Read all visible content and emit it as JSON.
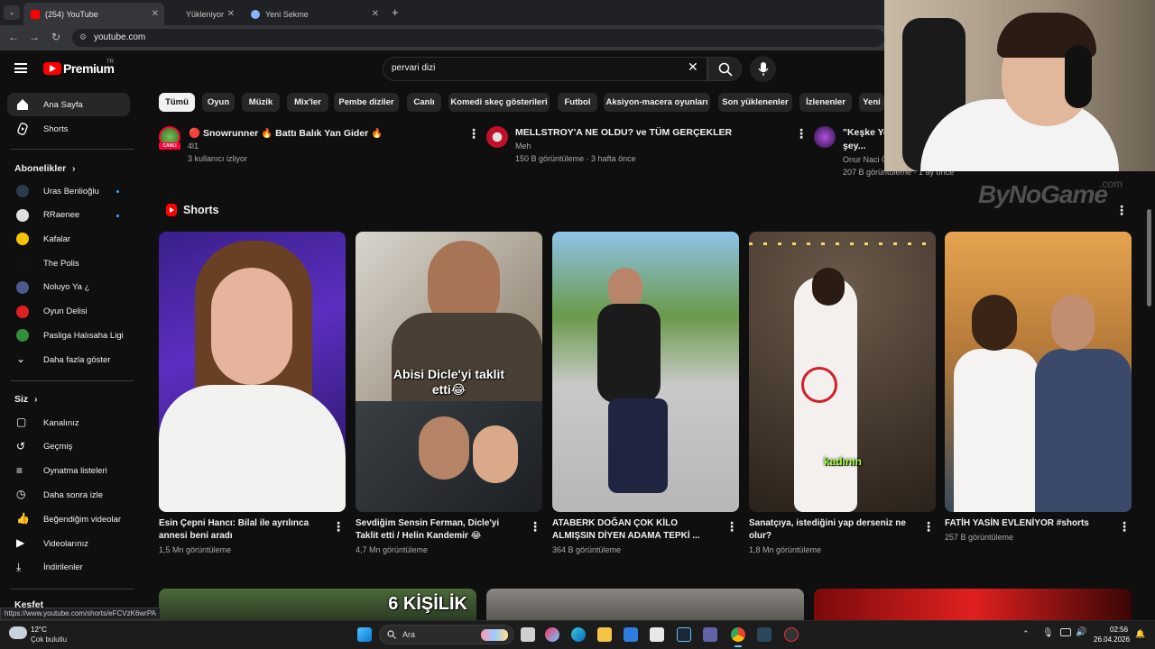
{
  "browser": {
    "tabs": [
      {
        "label": "(254) YouTube",
        "active": true
      },
      {
        "label": "Yükleniyor",
        "active": false
      },
      {
        "label": "Yeni Sekme",
        "active": false
      }
    ],
    "new_tab": "+",
    "url": "youtube.com",
    "status_url": "https://www.youtube.com/shorts/eFCVzK6wrPA"
  },
  "header": {
    "logo_text": "Premium",
    "logo_region": "TR",
    "search_value": "pervari dizi"
  },
  "sidebar": {
    "main": [
      {
        "label": "Ana Sayfa",
        "icon": "home-icon",
        "active": true
      },
      {
        "label": "Shorts",
        "icon": "shorts-icon",
        "active": false
      }
    ],
    "subs_heading": "Abonelikler",
    "subscriptions": [
      {
        "label": "Uras Benlioğlu",
        "dot": true,
        "color": "#2a3b4c"
      },
      {
        "label": "RRaenee",
        "dot": true,
        "color": "#e0e0e0"
      },
      {
        "label": "Kafalar",
        "dot": false,
        "color": "#f5c400"
      },
      {
        "label": "The Polis",
        "dot": false,
        "color": "#111111"
      },
      {
        "label": "Noluyo Ya ¿",
        "dot": false,
        "color": "#4a5a8a"
      },
      {
        "label": "Oyun Delisi",
        "dot": false,
        "color": "#e02020"
      },
      {
        "label": "Pasliga Halısaha Ligi",
        "dot": false,
        "color": "#2f8f3a"
      }
    ],
    "show_more": "Daha fazla göster",
    "you_heading": "Siz",
    "you_items": [
      {
        "label": "Kanalınız",
        "icon": "channel-icon"
      },
      {
        "label": "Geçmiş",
        "icon": "history-icon"
      },
      {
        "label": "Oynatma listeleri",
        "icon": "playlists-icon"
      },
      {
        "label": "Daha sonra izle",
        "icon": "watch-later-icon"
      },
      {
        "label": "Beğendiğim videolar",
        "icon": "like-icon"
      },
      {
        "label": "Videolarınız",
        "icon": "your-videos-icon"
      },
      {
        "label": "İndirilenler",
        "icon": "download-icon"
      }
    ],
    "explore_heading": "Keşfet"
  },
  "chips": [
    "Tümü",
    "Oyun",
    "Müzik",
    "Mix'ler",
    "Pembe diziler",
    "Canlı",
    "Komedi skeç gösterileri",
    "Futbol",
    "Aksiyon-macera oyunları",
    "Son yüklenenler",
    "İzlenenler",
    "Yeni"
  ],
  "top_videos": [
    {
      "title": "🔴 Snowrunner 🔥 Battı Balık Yan Gider 🔥",
      "channel": "4l1",
      "meta": "3 kullanıcı izliyor",
      "live_badge": "CANLI"
    },
    {
      "title": "MELLSTROY'A NE OLDU? ve TÜM GERÇEKLER",
      "channel": "Meh",
      "meta": "150 B görüntüleme · 3 hafta önce"
    },
    {
      "title": "\"Keşke Yo",
      "title2": "şey...",
      "channel": "Onur Naci Ö",
      "meta": "207 B görüntüleme · 1 ay önce"
    }
  ],
  "shorts": {
    "heading": "Shorts",
    "items": [
      {
        "title": "Esin Çepni Hancı: Bilal ile ayrılınca annesi beni aradı",
        "views": "1,5 Mn görüntüleme"
      },
      {
        "title": "Sevdiğim Sensin Ferman, Dicle'yi Taklit etti / Helin Kandemir 😂",
        "views": "4,7 Mn görüntüleme",
        "caption": "Abisi Dicle'yi taklit etti😂"
      },
      {
        "title": "ATABERK DOĞAN ÇOK KİLO ALMIŞSIN DİYEN ADAMA TEPKİ ...",
        "views": "364 B görüntüleme"
      },
      {
        "title": "Sanatçıya, istediğini yap derseniz ne olur?",
        "views": "1,8 Mn görüntüleme",
        "caption": "kadının"
      },
      {
        "title": "FATİH YASİN EVLENİYOR #shorts",
        "views": "257 B görüntüleme"
      }
    ]
  },
  "bottom_row": {
    "caption": "6 KİŞİLİK"
  },
  "overlay": {
    "watermark": "ByNoGame",
    "watermark_domain": ".com"
  },
  "taskbar": {
    "temp": "12°C",
    "weather": "Çok bulutlu",
    "search_label": "Ara",
    "time": "02:56",
    "date": "26.04.2026"
  }
}
